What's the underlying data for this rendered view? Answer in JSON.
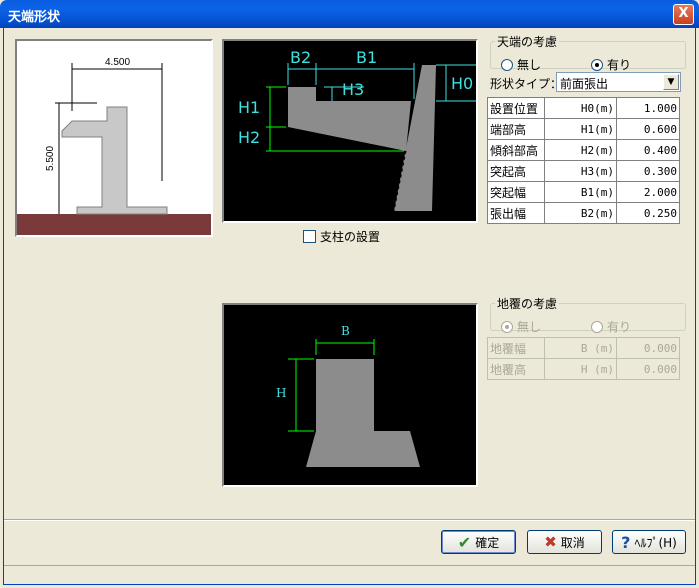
{
  "window": {
    "title": "天端形状",
    "close": "X"
  },
  "preview": {
    "width_label": "4.500",
    "height_label": "5.500"
  },
  "diagram1": {
    "labels": {
      "B2": "B2",
      "B1": "B1",
      "H3": "H3",
      "H0": "H0",
      "H1": "H1",
      "H2": "H2"
    }
  },
  "support_checkbox": {
    "label": "支柱の設置",
    "checked": false
  },
  "top_group": {
    "legend": "天端の考慮",
    "options": [
      {
        "label": "無し",
        "selected": false
      },
      {
        "label": "有り",
        "selected": true
      }
    ]
  },
  "shape_type": {
    "label": "形状タイプ：",
    "value": "前面張出"
  },
  "params": [
    {
      "name": "設置位置",
      "symbol": "H0(m)",
      "value": "1.000"
    },
    {
      "name": "端部高",
      "symbol": "H1(m)",
      "value": "0.600"
    },
    {
      "name": "傾斜部高",
      "symbol": "H2(m)",
      "value": "0.400"
    },
    {
      "name": "突起高",
      "symbol": "H3(m)",
      "value": "0.300"
    },
    {
      "name": "突起幅",
      "symbol": "B1(m)",
      "value": "2.000"
    },
    {
      "name": "張出幅",
      "symbol": "B2(m)",
      "value": "0.250"
    }
  ],
  "diagram2": {
    "labels": {
      "B": "B",
      "H": "H"
    }
  },
  "soil_group": {
    "legend": "地覆の考慮",
    "options": [
      {
        "label": "無し",
        "selected": true
      },
      {
        "label": "有り",
        "selected": false
      }
    ]
  },
  "soil_params": [
    {
      "name": "地覆幅",
      "symbol": "B (m)",
      "value": "0.000"
    },
    {
      "name": "地覆高",
      "symbol": "H (m)",
      "value": "0.000"
    }
  ],
  "buttons": {
    "ok": "確定",
    "cancel": "取消",
    "help": "ﾍﾙﾌﾟ(H)"
  },
  "colors": {
    "ground": "#7b3a3a",
    "diagram_bg": "#000000",
    "dim_cyan": "#40e0e0",
    "dim_green": "#00ff00",
    "shape_gray": "#8c8c8c"
  }
}
